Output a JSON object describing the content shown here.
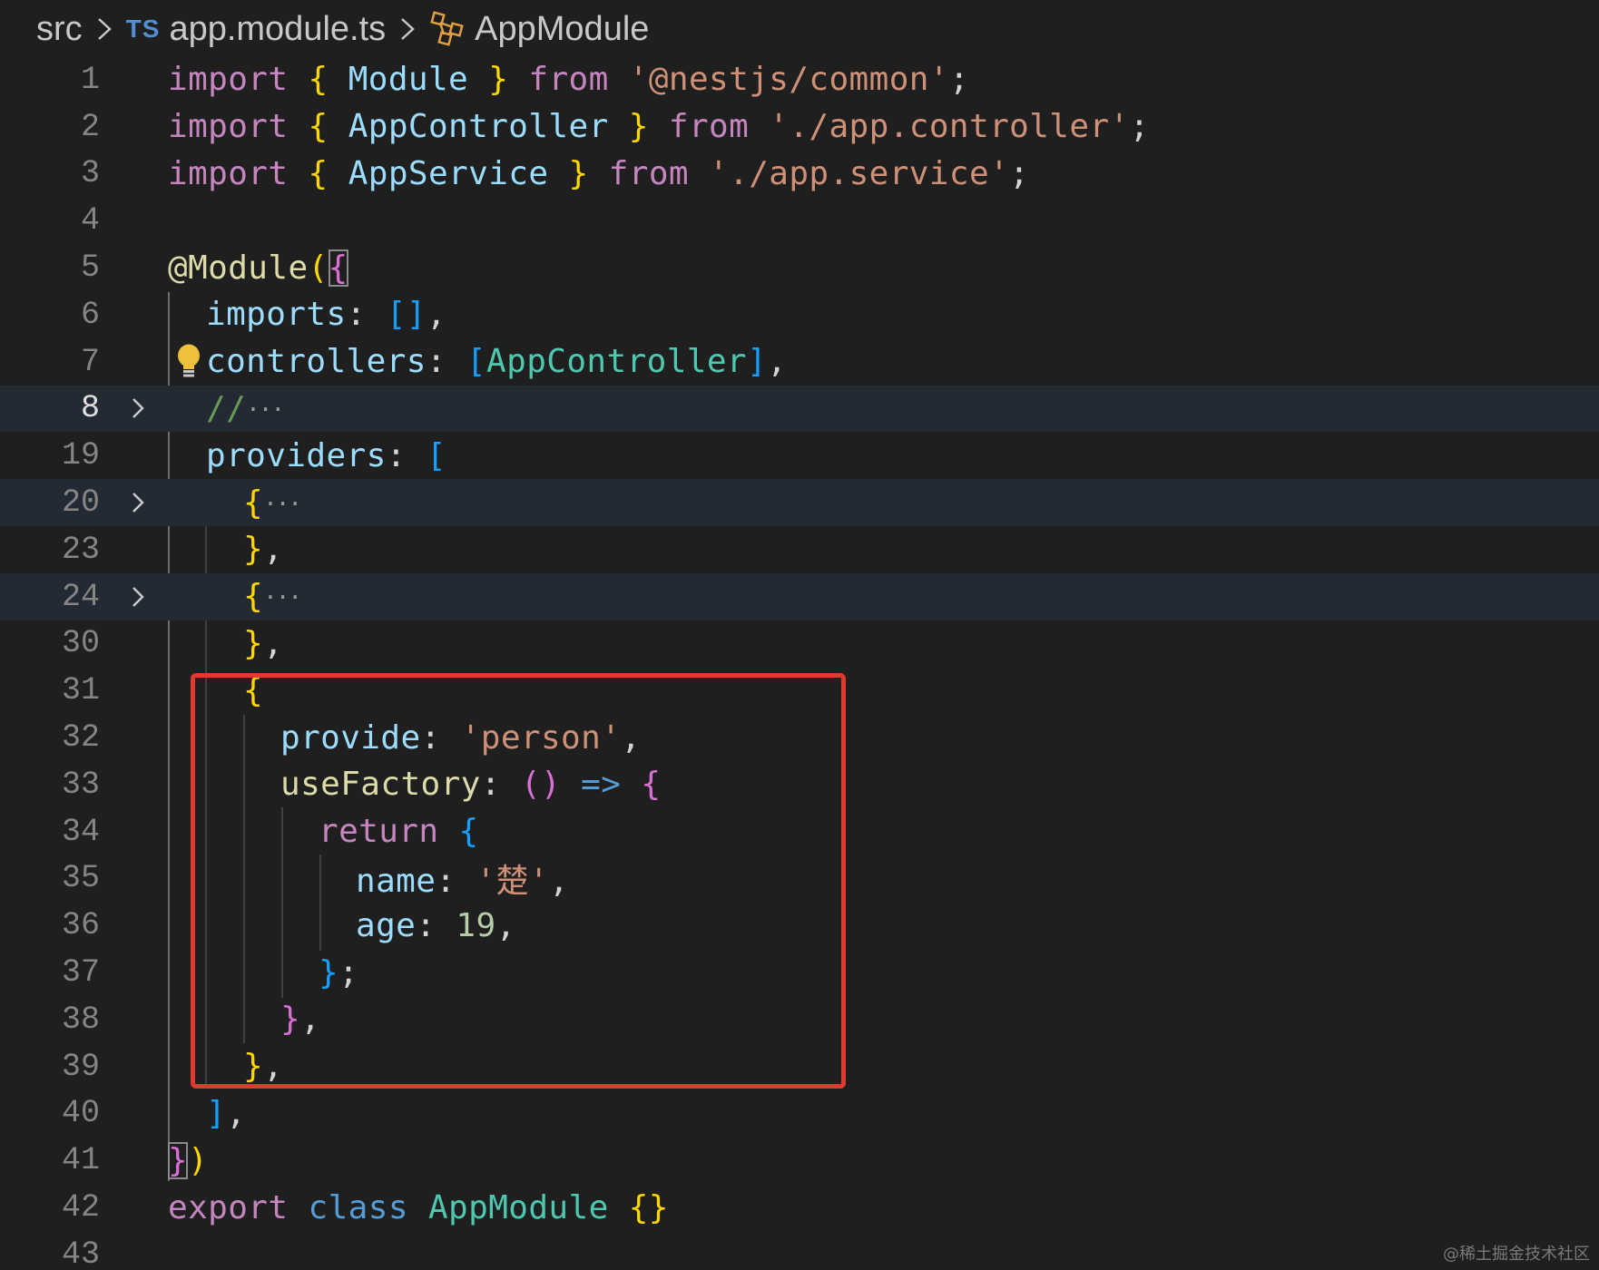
{
  "breadcrumb": {
    "folder": "src",
    "file_type_badge": "TS",
    "file": "app.module.ts",
    "symbol": "AppModule",
    "separator_icon": "chevron-right-icon",
    "symbol_icon": "symbol-module-icon"
  },
  "lines": {
    "l1": {
      "num": "1",
      "p1": "import",
      "p2": " ",
      "p3": "{",
      "p4": " ",
      "p5": "Module",
      "p6": " ",
      "p7": "}",
      "p8": " ",
      "p9": "from",
      "p10": " ",
      "p11": "'@nestjs/common'",
      "p12": ";"
    },
    "l2": {
      "num": "2",
      "p1": "import",
      "p2": " ",
      "p3": "{",
      "p4": " ",
      "p5": "AppController",
      "p6": " ",
      "p7": "}",
      "p8": " ",
      "p9": "from",
      "p10": " ",
      "p11": "'./app.controller'",
      "p12": ";"
    },
    "l3": {
      "num": "3",
      "p1": "import",
      "p2": " ",
      "p3": "{",
      "p4": " ",
      "p5": "AppService",
      "p6": " ",
      "p7": "}",
      "p8": " ",
      "p9": "from",
      "p10": " ",
      "p11": "'./app.service'",
      "p12": ";"
    },
    "l4": {
      "num": "4"
    },
    "l5": {
      "num": "5",
      "p1": "@Module",
      "p2": "(",
      "p3": "{"
    },
    "l6": {
      "num": "6",
      "p1": "imports",
      "p2": ": ",
      "p3": "[]",
      "p4": ","
    },
    "l7": {
      "num": "7",
      "p1": "controllers",
      "p2": ": ",
      "p3": "[",
      "p4": "AppController",
      "p5": "]",
      "p6": ","
    },
    "l8": {
      "num": "8",
      "p1": "//",
      "p2": "···"
    },
    "l19": {
      "num": "19",
      "p1": "providers",
      "p2": ": ",
      "p3": "["
    },
    "l20": {
      "num": "20",
      "p1": "{",
      "p2": "···"
    },
    "l23": {
      "num": "23",
      "p1": "}",
      "p2": ","
    },
    "l24": {
      "num": "24",
      "p1": "{",
      "p2": "···"
    },
    "l30": {
      "num": "30",
      "p1": "}",
      "p2": ","
    },
    "l31": {
      "num": "31",
      "p1": "{"
    },
    "l32": {
      "num": "32",
      "p1": "provide",
      "p2": ": ",
      "p3": "'person'",
      "p4": ","
    },
    "l33": {
      "num": "33",
      "p1": "useFactory",
      "p2": ": ",
      "p3": "()",
      "p4": " ",
      "p5": "=>",
      "p6": " ",
      "p7": "{"
    },
    "l34": {
      "num": "34",
      "p1": "return",
      "p2": " ",
      "p3": "{"
    },
    "l35": {
      "num": "35",
      "p1": "name",
      "p2": ": ",
      "p3": "'楚'",
      "p4": ","
    },
    "l36": {
      "num": "36",
      "p1": "age",
      "p2": ": ",
      "p3": "19",
      "p4": ","
    },
    "l37": {
      "num": "37",
      "p1": "}",
      "p2": ";"
    },
    "l38": {
      "num": "38",
      "p1": "}",
      "p2": ","
    },
    "l39": {
      "num": "39",
      "p1": "}",
      "p2": ","
    },
    "l40": {
      "num": "40",
      "p1": "]",
      "p2": ","
    },
    "l41": {
      "num": "41",
      "p1": "}",
      "p2": ")"
    },
    "l42": {
      "num": "42",
      "p1": "export",
      "p2": " ",
      "p3": "class",
      "p4": " ",
      "p5": "AppModule",
      "p6": " ",
      "p7": "{}"
    },
    "l43": {
      "num": "43"
    }
  },
  "watermark": "@稀土掘金技术社区",
  "colors": {
    "background": "#1f1f1f",
    "folded_line": "#232a33",
    "highlight_box": "#e0392e",
    "keyword": "#c586c0",
    "string": "#ce9178",
    "identifier": "#9cdcfe",
    "class": "#4ec9b0",
    "number": "#b5cea8",
    "bracket_gold": "#ffd700",
    "bracket_purple": "#da70d6",
    "bracket_blue": "#179fff"
  }
}
